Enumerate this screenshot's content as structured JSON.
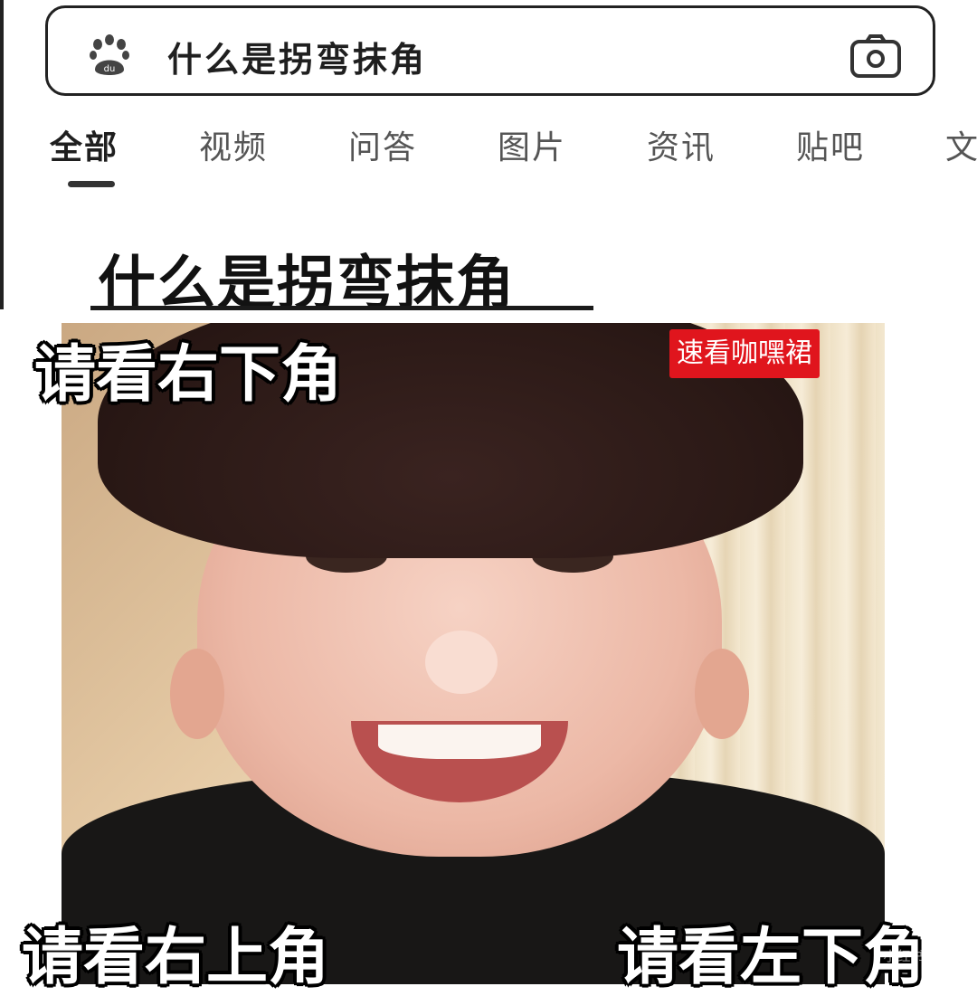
{
  "search": {
    "query": "什么是拐弯抹角",
    "logo_icon": "baidu-paw-icon",
    "camera_icon": "camera-icon"
  },
  "tabs": [
    {
      "label": "全部",
      "active": true
    },
    {
      "label": "视频",
      "active": false
    },
    {
      "label": "问答",
      "active": false
    },
    {
      "label": "图片",
      "active": false
    },
    {
      "label": "资讯",
      "active": false
    },
    {
      "label": "贴吧",
      "active": false
    },
    {
      "label": "文",
      "active": false
    }
  ],
  "headline": "什么是拐弯抹角",
  "captions": {
    "top_left": "请看右下角",
    "bottom_left": "请看右上角",
    "bottom_right": "请看左下角"
  },
  "badge": "速看咖嘿裙",
  "watermark": "小红书号：2…",
  "colors": {
    "badge_red": "#e0151d",
    "text_dark": "#1f1f1f"
  }
}
